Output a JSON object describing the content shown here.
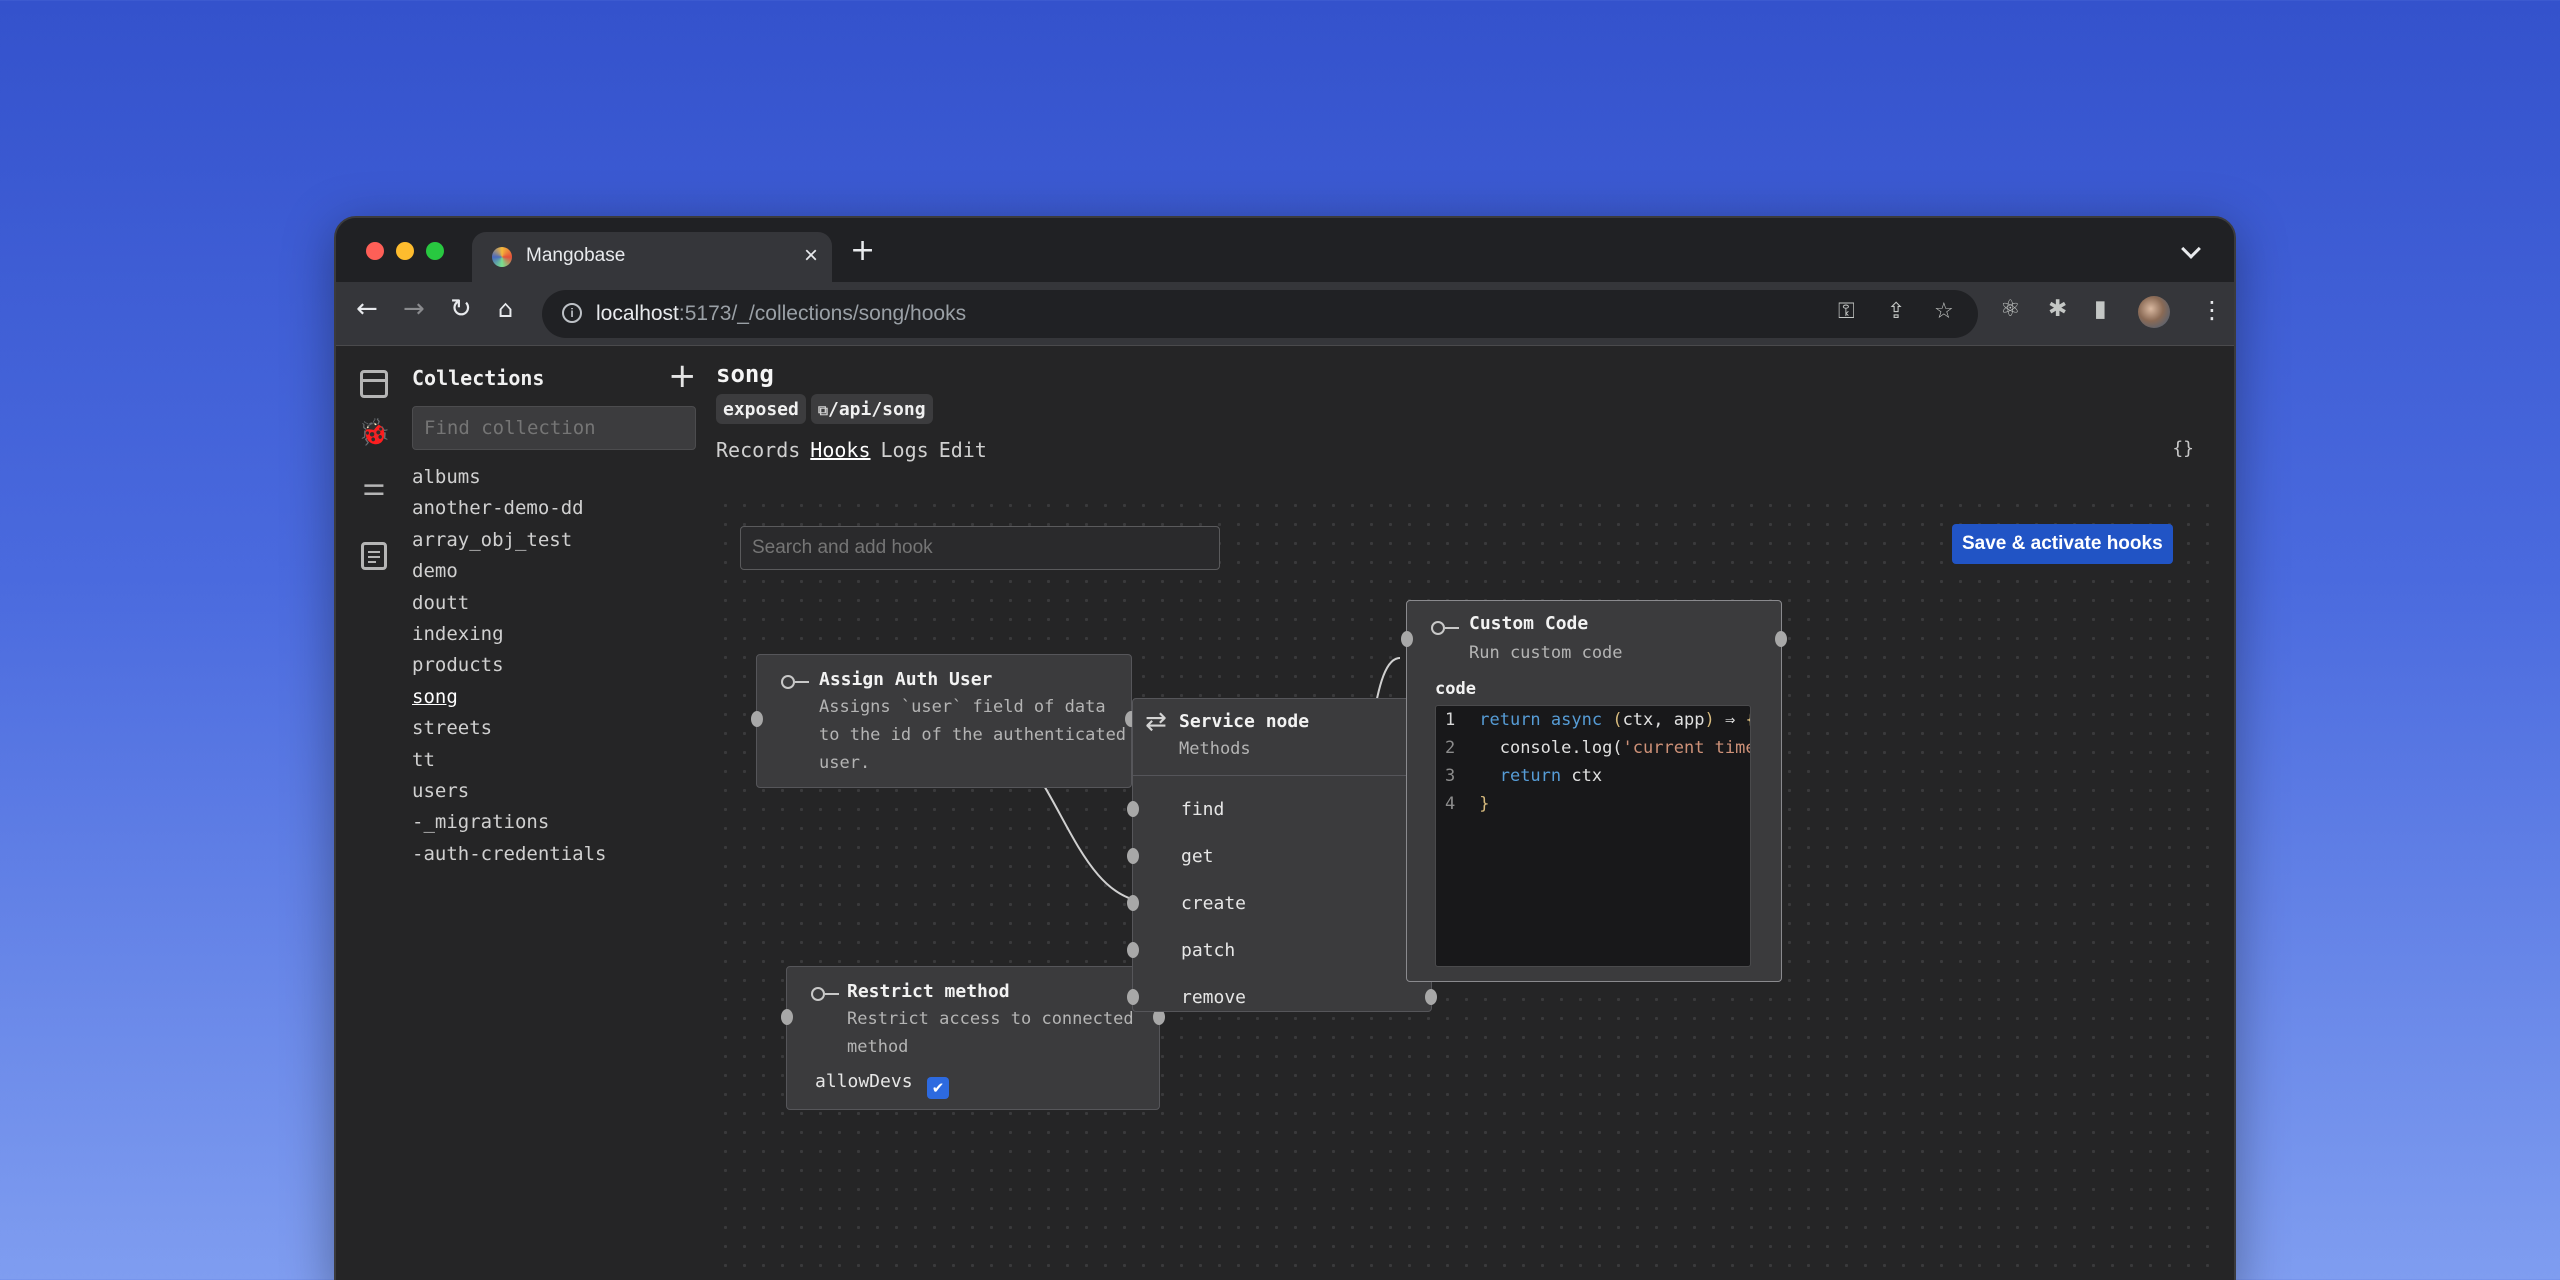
{
  "browser": {
    "tab_title": "Mangobase",
    "tab_close": "×",
    "new_tab": "+",
    "url_host": "localhost",
    "url_path": ":5173/_/collections/song/hooks"
  },
  "sidebar": {
    "title": "Collections",
    "add_label": "+",
    "search_placeholder": "Find collection",
    "items": [
      {
        "label": "albums"
      },
      {
        "label": "another-demo-dd"
      },
      {
        "label": "array_obj_test"
      },
      {
        "label": "demo"
      },
      {
        "label": "doutt"
      },
      {
        "label": "indexing"
      },
      {
        "label": "products"
      },
      {
        "label": "song"
      },
      {
        "label": "streets"
      },
      {
        "label": "tt"
      },
      {
        "label": "users"
      },
      {
        "label": "-_migrations"
      },
      {
        "label": "-auth-credentials"
      }
    ],
    "active": "song"
  },
  "collection": {
    "name": "song",
    "badge_exposed": "exposed",
    "badge_path": "/api/song",
    "tabs": [
      "Records",
      "Hooks",
      "Logs",
      "Edit"
    ],
    "active_tab": "Hooks",
    "braces_label": "{}"
  },
  "hooks": {
    "search_placeholder": "Search and add hook",
    "save_label": "Save & activate hooks",
    "nodes": {
      "assign_auth": {
        "title": "Assign Auth User",
        "desc": [
          "Assigns `user` field of data",
          "to the id of the authenticated",
          "user."
        ]
      },
      "restrict": {
        "title": "Restrict method",
        "desc": [
          "Restrict access to connected",
          "method"
        ],
        "option_label": "allowDevs",
        "option_checked": true
      },
      "service": {
        "title": "Service node",
        "subtitle": "Methods",
        "methods": [
          "find",
          "get",
          "create",
          "patch",
          "remove"
        ]
      },
      "custom_code": {
        "title": "Custom Code",
        "subtitle": "Run custom code",
        "field_label": "code",
        "line_numbers": [
          "1",
          "2",
          "3",
          "4"
        ]
      }
    }
  },
  "colors": {
    "accent": "#2154c5",
    "background_top": "#3452cc",
    "background_bottom": "#7f9df0"
  }
}
